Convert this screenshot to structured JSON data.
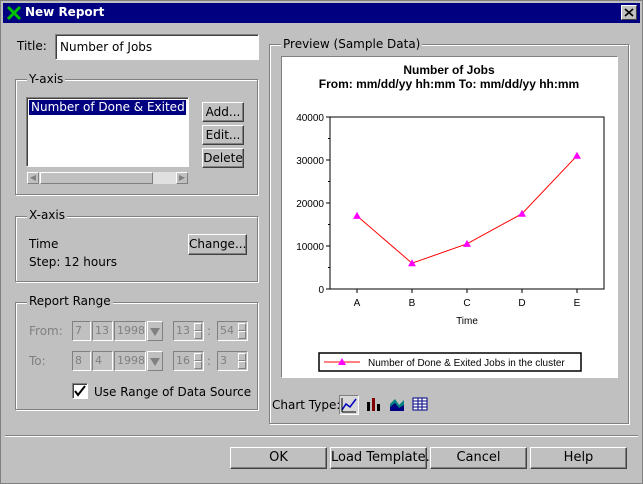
{
  "window": {
    "title": "New Report"
  },
  "title_field": {
    "label": "Title:",
    "value": "Number of Jobs"
  },
  "y_axis": {
    "legend": "Y-axis",
    "items": [
      "Number of Done & Exited Jo"
    ],
    "add_label": "Add...",
    "edit_label": "Edit...",
    "delete_label": "Delete"
  },
  "x_axis": {
    "legend": "X-axis",
    "field": "Time",
    "step": "Step: 12 hours",
    "change_label": "Change..."
  },
  "report_range": {
    "legend": "Report Range",
    "from_label": "From:",
    "to_label": "To:",
    "from": {
      "month": "7",
      "day": "13",
      "year": "1998",
      "hour": "13",
      "minute": "54"
    },
    "to": {
      "month": "8",
      "day": "4",
      "year": "1998",
      "hour": "16",
      "minute": "3"
    },
    "time_sep": ":",
    "use_source_label": "Use Range of Data Source",
    "use_source_checked": true
  },
  "preview": {
    "legend": "Preview (Sample Data)",
    "chart_type_label": "Chart Type:",
    "chart_types": [
      "line-chart-icon",
      "bar-chart-icon",
      "area-chart-icon",
      "table-chart-icon"
    ],
    "selected_chart_type": "line-chart-icon"
  },
  "chart_data": {
    "type": "line",
    "title": "Number of Jobs",
    "subtitle": "From: mm/dd/yy hh:mm To: mm/dd/yy hh:mm",
    "xlabel": "Time",
    "ylabel": "",
    "categories": [
      "A",
      "B",
      "C",
      "D",
      "E"
    ],
    "ylim": [
      0,
      40000
    ],
    "yticks": [
      "0",
      "10000",
      "20000",
      "30000",
      "40000"
    ],
    "series": [
      {
        "name": "Number of Done & Exited Jobs in the cluster",
        "values": [
          17000,
          6000,
          10500,
          17500,
          31000
        ],
        "color": "#ff00ff",
        "line_color": "#ff0000"
      }
    ],
    "legend_position": "bottom"
  },
  "buttons": {
    "ok": "OK",
    "load_template": "Load Template...",
    "cancel": "Cancel",
    "help": "Help"
  }
}
